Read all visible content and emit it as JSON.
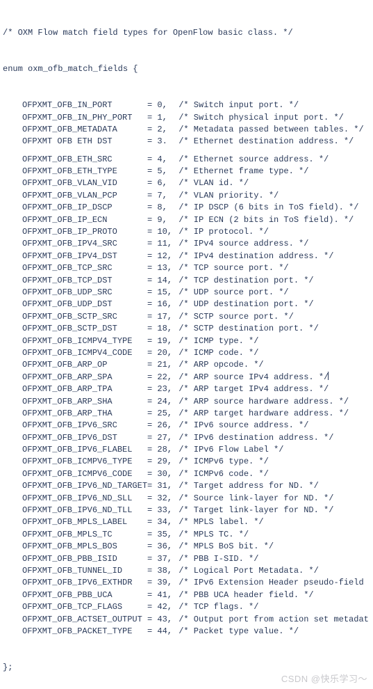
{
  "header_comment": "/* OXM Flow match field types for OpenFlow basic class. */",
  "enum_decl": "enum oxm_ofb_match_fields {",
  "close": "};",
  "watermark": "CSDN @快乐学习～",
  "fields": [
    {
      "name": "OFPXMT_OFB_IN_PORT",
      "value": "= 0,",
      "comment": "/* Switch input port. */"
    },
    {
      "name": "OFPXMT_OFB_IN_PHY_PORT",
      "value": "= 1,",
      "comment": "/* Switch physical input port. */"
    },
    {
      "name": "OFPXMT_OFB_METADATA",
      "value": "= 2,",
      "comment": "/* Metadata passed between tables. */"
    },
    {
      "name": "OFPXMT OFB ETH DST",
      "value": "= 3.",
      "comment": "/* Ethernet destination address. */"
    },
    {
      "name": "OFPXMT_OFB_ETH_SRC",
      "value": "= 4,",
      "comment": "/* Ethernet source address. */"
    },
    {
      "name": "OFPXMT_OFB_ETH_TYPE",
      "value": "= 5,",
      "comment": "/* Ethernet frame type. */"
    },
    {
      "name": "OFPXMT_OFB_VLAN_VID",
      "value": "= 6,",
      "comment": "/* VLAN id. */"
    },
    {
      "name": "OFPXMT_OFB_VLAN_PCP",
      "value": "= 7,",
      "comment": "/* VLAN priority. */"
    },
    {
      "name": "OFPXMT_OFB_IP_DSCP",
      "value": "= 8,",
      "comment": "/* IP DSCP (6 bits in ToS field). */"
    },
    {
      "name": "OFPXMT_OFB_IP_ECN",
      "value": "= 9,",
      "comment": "/* IP ECN (2 bits in ToS field). */"
    },
    {
      "name": "OFPXMT_OFB_IP_PROTO",
      "value": "= 10,",
      "comment": "/* IP protocol. */"
    },
    {
      "name": "OFPXMT_OFB_IPV4_SRC",
      "value": "= 11,",
      "comment": "/* IPv4 source address. */"
    },
    {
      "name": "OFPXMT_OFB_IPV4_DST",
      "value": "= 12,",
      "comment": "/* IPv4 destination address. */"
    },
    {
      "name": "OFPXMT_OFB_TCP_SRC",
      "value": "= 13,",
      "comment": "/* TCP source port. */"
    },
    {
      "name": "OFPXMT_OFB_TCP_DST",
      "value": "= 14,",
      "comment": "/* TCP destination port. */"
    },
    {
      "name": "OFPXMT_OFB_UDP_SRC",
      "value": "= 15,",
      "comment": "/* UDP source port. */"
    },
    {
      "name": "OFPXMT_OFB_UDP_DST",
      "value": "= 16,",
      "comment": "/* UDP destination port. */"
    },
    {
      "name": "OFPXMT_OFB_SCTP_SRC",
      "value": "= 17,",
      "comment": "/* SCTP source port. */"
    },
    {
      "name": "OFPXMT_OFB_SCTP_DST",
      "value": "= 18,",
      "comment": "/* SCTP destination port. */"
    },
    {
      "name": "OFPXMT_OFB_ICMPV4_TYPE",
      "value": "= 19,",
      "comment": "/* ICMP type. */"
    },
    {
      "name": "OFPXMT_OFB_ICMPV4_CODE",
      "value": "= 20,",
      "comment": "/* ICMP code. */"
    },
    {
      "name": "OFPXMT_OFB_ARP_OP",
      "value": "= 21,",
      "comment": "/* ARP opcode. */"
    },
    {
      "name": "OFPXMT_OFB_ARP_SPA",
      "value": "= 22,",
      "comment": "/* ARP source IPv4 address. */",
      "cursor": true
    },
    {
      "name": "OFPXMT_OFB_ARP_TPA",
      "value": "= 23,",
      "comment": "/* ARP target IPv4 address. */"
    },
    {
      "name": "OFPXMT_OFB_ARP_SHA",
      "value": "= 24,",
      "comment": "/* ARP source hardware address. */"
    },
    {
      "name": "OFPXMT_OFB_ARP_THA",
      "value": "= 25,",
      "comment": "/* ARP target hardware address. */"
    },
    {
      "name": "OFPXMT_OFB_IPV6_SRC",
      "value": "= 26,",
      "comment": "/* IPv6 source address. */"
    },
    {
      "name": "OFPXMT_OFB_IPV6_DST",
      "value": "= 27,",
      "comment": "/* IPv6 destination address. */"
    },
    {
      "name": "OFPXMT_OFB_IPV6_FLABEL",
      "value": "= 28,",
      "comment": "/* IPv6 Flow Label */"
    },
    {
      "name": "OFPXMT_OFB_ICMPV6_TYPE",
      "value": "= 29,",
      "comment": "/* ICMPv6 type. */"
    },
    {
      "name": "OFPXMT_OFB_ICMPV6_CODE",
      "value": "= 30,",
      "comment": "/* ICMPv6 code. */"
    },
    {
      "name": "OFPXMT_OFB_IPV6_ND_TARGET",
      "value": "= 31,",
      "comment": "/* Target address for ND. */"
    },
    {
      "name": "OFPXMT_OFB_IPV6_ND_SLL",
      "value": "= 32,",
      "comment": "/* Source link-layer for ND. */"
    },
    {
      "name": "OFPXMT_OFB_IPV6_ND_TLL",
      "value": "= 33,",
      "comment": "/* Target link-layer for ND. */"
    },
    {
      "name": "OFPXMT_OFB_MPLS_LABEL",
      "value": "= 34,",
      "comment": "/* MPLS label. */"
    },
    {
      "name": "OFPXMT_OFB_MPLS_TC",
      "value": "= 35,",
      "comment": "/* MPLS TC. */"
    },
    {
      "name": "OFPXMT_OFB_MPLS_BOS",
      "value": "= 36,",
      "comment": "/* MPLS BoS bit. */"
    },
    {
      "name": "OFPXMT_OFB_PBB_ISID",
      "value": "= 37,",
      "comment": "/* PBB I-SID. */"
    },
    {
      "name": "OFPXMT_OFB_TUNNEL_ID",
      "value": "= 38,",
      "comment": "/* Logical Port Metadata. */"
    },
    {
      "name": "OFPXMT_OFB_IPV6_EXTHDR",
      "value": "= 39,",
      "comment": "/* IPv6 Extension Header pseudo-field"
    },
    {
      "name": "OFPXMT_OFB_PBB_UCA",
      "value": "= 41,",
      "comment": "/* PBB UCA header field. */"
    },
    {
      "name": "OFPXMT_OFB_TCP_FLAGS",
      "value": "= 42,",
      "comment": "/* TCP flags. */"
    },
    {
      "name": "OFPXMT_OFB_ACTSET_OUTPUT",
      "value": "= 43,",
      "comment": "/* Output port from action set metadat"
    },
    {
      "name": "OFPXMT_OFB_PACKET_TYPE",
      "value": "= 44,",
      "comment": "/* Packet type value. */"
    }
  ],
  "gap_after_index": 3
}
